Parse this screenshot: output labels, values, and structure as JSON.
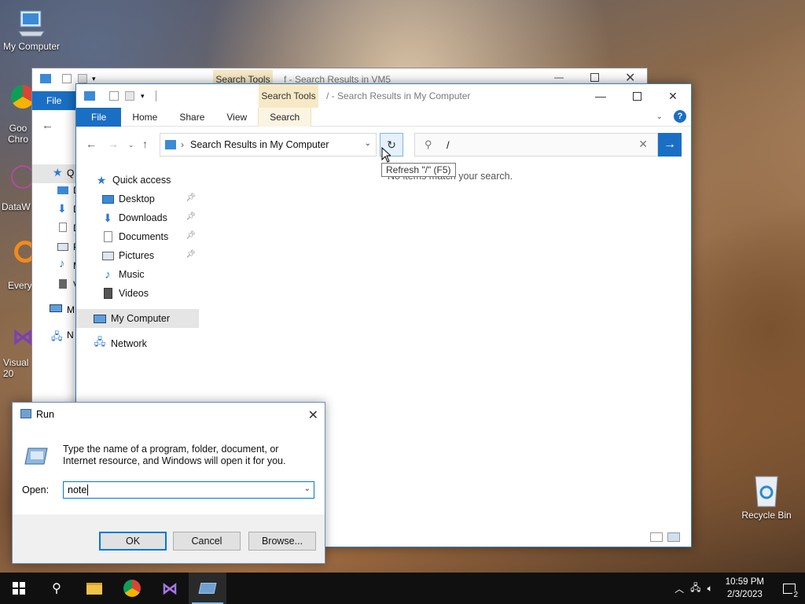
{
  "desktop": {
    "icons": [
      {
        "label": "My Computer"
      },
      {
        "label": "Goo\nChro"
      },
      {
        "label": "DataW"
      },
      {
        "label": "Every"
      },
      {
        "label": "Visual\n20"
      },
      {
        "label": "Recycle Bin"
      }
    ]
  },
  "back_window": {
    "search_tools_label": "Search Tools",
    "title": "f - Search Results in VM5",
    "file_tab": "File",
    "sidebar_letters": [
      "Q",
      "D",
      "D",
      "D",
      "P",
      "M",
      "V",
      "M",
      "N"
    ]
  },
  "explorer": {
    "search_tools_label": "Search Tools",
    "title": "/ - Search Results in My Computer",
    "tabs": [
      "File",
      "Home",
      "Share",
      "View",
      "Search"
    ],
    "address_text": "Search Results in My Computer",
    "search_value": "/",
    "tooltip": "Refresh \"/\" (F5)",
    "empty_message": "No items match your search.",
    "nav": {
      "quick_access": "Quick access",
      "items": [
        {
          "label": "Desktop",
          "pinned": true,
          "icon": "desktop-icon"
        },
        {
          "label": "Downloads",
          "pinned": true,
          "icon": "downloads-icon"
        },
        {
          "label": "Documents",
          "pinned": true,
          "icon": "documents-icon"
        },
        {
          "label": "Pictures",
          "pinned": true,
          "icon": "pictures-icon"
        },
        {
          "label": "Music",
          "pinned": false,
          "icon": "music-icon"
        },
        {
          "label": "Videos",
          "pinned": false,
          "icon": "videos-icon"
        }
      ],
      "my_computer": "My Computer",
      "network": "Network"
    }
  },
  "run_dialog": {
    "title": "Run",
    "description": "Type the name of a program, folder, document, or Internet resource, and Windows will open it for you.",
    "open_label": "Open:",
    "input_value": "note",
    "ok": "OK",
    "cancel": "Cancel",
    "browse": "Browse..."
  },
  "taskbar": {
    "time": "10:59 PM",
    "date": "2/3/2023",
    "notification_count": "2"
  },
  "colors": {
    "accent": "#1a6fc4",
    "search_tools": "#f7e9c6",
    "taskbar": "#101010"
  }
}
